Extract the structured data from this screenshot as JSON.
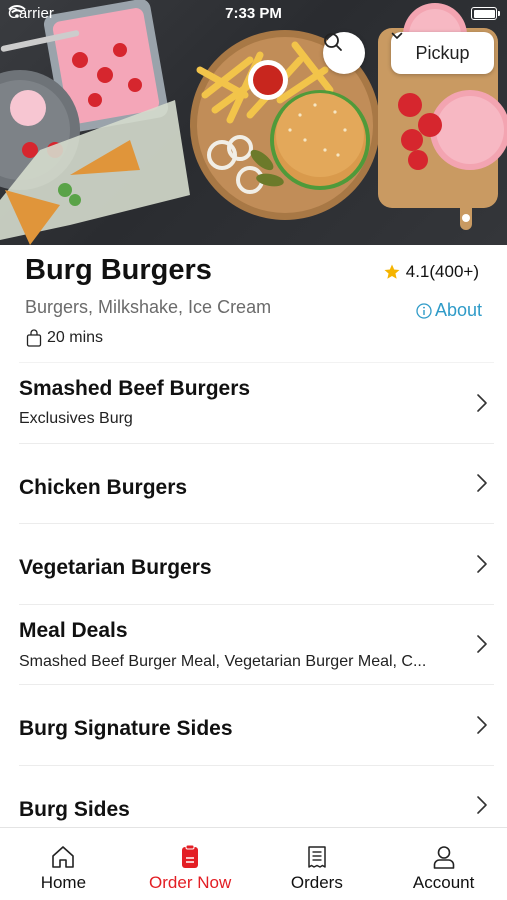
{
  "status_bar": {
    "carrier": "Carrier",
    "time": "7:33 PM"
  },
  "header": {
    "pickup_label": "Pickup"
  },
  "restaurant": {
    "name": "Burg Burgers",
    "rating": "4.1(400+)",
    "cuisines": "Burgers, Milkshake, Ice Cream",
    "about_label": "About",
    "delivery_time": "20 mins"
  },
  "menu": [
    {
      "title": "Smashed Beef Burgers",
      "subtitle": "Exclusives Burg"
    },
    {
      "title": "Chicken Burgers",
      "subtitle": ""
    },
    {
      "title": "Vegetarian Burgers",
      "subtitle": ""
    },
    {
      "title": "Meal Deals",
      "subtitle": "Smashed Beef Burger Meal, Vegetarian Burger Meal, C..."
    },
    {
      "title": "Burg Signature Sides",
      "subtitle": ""
    },
    {
      "title": "Burg Sides",
      "subtitle": ""
    }
  ],
  "tabs": [
    {
      "label": "Home",
      "icon": "home-icon",
      "active": false
    },
    {
      "label": "Order Now",
      "icon": "order-icon",
      "active": true
    },
    {
      "label": "Orders",
      "icon": "receipt-icon",
      "active": false
    },
    {
      "label": "Account",
      "icon": "person-icon",
      "active": false
    }
  ],
  "colors": {
    "accent": "#e31e24",
    "link": "#2f9bc8",
    "star": "#f5b400"
  }
}
